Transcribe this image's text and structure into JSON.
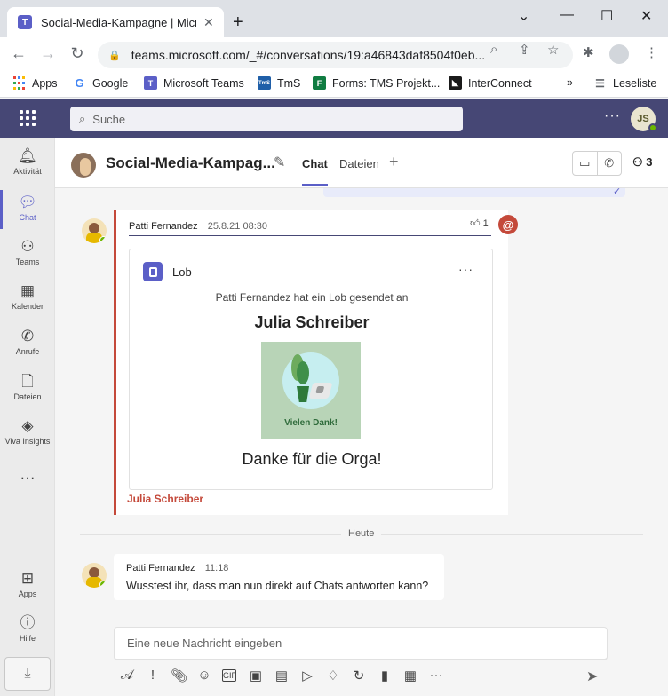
{
  "browser": {
    "tab_title": "Social-Media-Kampagne | Microsoft Teams",
    "tab_close": "✕",
    "new_tab": "+",
    "url": "teams.microsoft.com/_#/conversations/19:a46843daf8504f0eb...",
    "bookmarks": [
      {
        "label": "Apps",
        "icon": "apps-grid-icon"
      },
      {
        "label": "Google",
        "icon": "google-icon",
        "glyph": "G",
        "color": "#4285f4"
      },
      {
        "label": "Microsoft Teams",
        "icon": "teams-icon",
        "glyph": "T",
        "color": "#5b5fc7"
      },
      {
        "label": "TmS",
        "icon": "tms-icon",
        "glyph": "TmS",
        "color": "#1f5fa8"
      },
      {
        "label": "Forms: TMS Projekt...",
        "icon": "forms-icon",
        "glyph": "F",
        "color": "#107c41"
      },
      {
        "label": "InterConnect",
        "icon": "interconnect-icon",
        "glyph": "◣",
        "color": "#1a1a1a"
      }
    ],
    "reading_list": "Leseliste"
  },
  "teams": {
    "search_placeholder": "Suche",
    "user_initials": "JS",
    "rail": [
      {
        "label": "Aktivität",
        "icon": "bell-icon"
      },
      {
        "label": "Chat",
        "icon": "chat-icon",
        "active": true
      },
      {
        "label": "Teams",
        "icon": "teams-people-icon"
      },
      {
        "label": "Kalender",
        "icon": "calendar-icon"
      },
      {
        "label": "Anrufe",
        "icon": "phone-icon"
      },
      {
        "label": "Dateien",
        "icon": "file-icon"
      },
      {
        "label": "Viva Insights",
        "icon": "viva-insights-icon"
      }
    ],
    "rail_bottom": [
      {
        "label": "Apps",
        "icon": "apps-icon"
      },
      {
        "label": "Hilfe",
        "icon": "help-icon"
      }
    ]
  },
  "chat": {
    "title": "Social-Media-Kampag...",
    "tabs": [
      "Chat",
      "Dateien"
    ],
    "participants": "3",
    "messages": [
      {
        "author": "Patti Fernandez",
        "time": "25.8.21 08:30",
        "reaction_count": "1",
        "card": {
          "app": "Lob",
          "subtitle": "Patti Fernandez hat ein Lob gesendet an",
          "recipient": "Julia Schreiber",
          "image_caption": "Vielen Dank!",
          "message": "Danke für die Orga!"
        },
        "mention": "Julia Schreiber"
      },
      {
        "author": "Patti Fernandez",
        "time": "11:18",
        "text": "Wusstest ihr, dass man nun direkt auf Chats antworten kann?"
      }
    ],
    "divider": "Heute",
    "compose_placeholder": "Eine neue Nachricht eingeben"
  },
  "colors": {
    "teams_header": "#464775",
    "accent": "#5b5fc7",
    "mention_red": "#c4493a",
    "presence_green": "#6bb700"
  }
}
